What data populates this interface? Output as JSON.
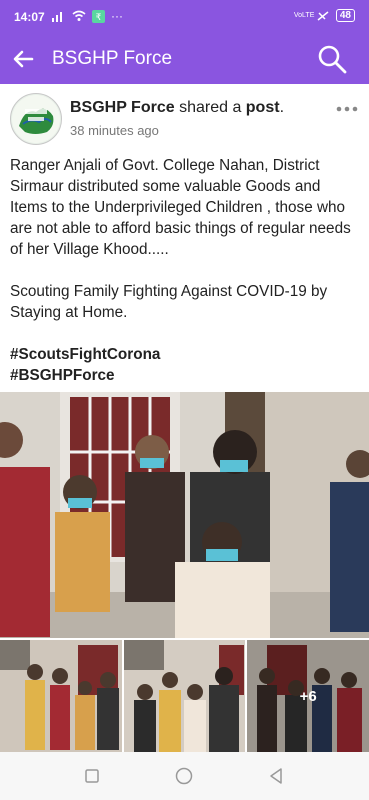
{
  "status": {
    "time": "14:07",
    "battery": "48",
    "network": "VoLTE"
  },
  "appbar": {
    "title": "BSGHP Force"
  },
  "post": {
    "author": "BSGHP Force",
    "action_text": " shared a ",
    "action_object": "post",
    "period": ".",
    "time_ago": "38 minutes ago",
    "paragraph1": "Ranger Anjali of Govt. College Nahan, District Sirmaur distributed some valuable Goods and Items to the Underprivileged Children , those who are not able to afford basic things of regular needs of her Village Khood.....",
    "paragraph2": "Scouting Family Fighting Against COVID-19 by Staying at Home.",
    "hashtag1": "#ScoutsFightCorona",
    "hashtag2": "#BSGHPForce"
  },
  "gallery": {
    "more_count": "+6"
  },
  "colors": {
    "accent": "#8a55e0"
  }
}
